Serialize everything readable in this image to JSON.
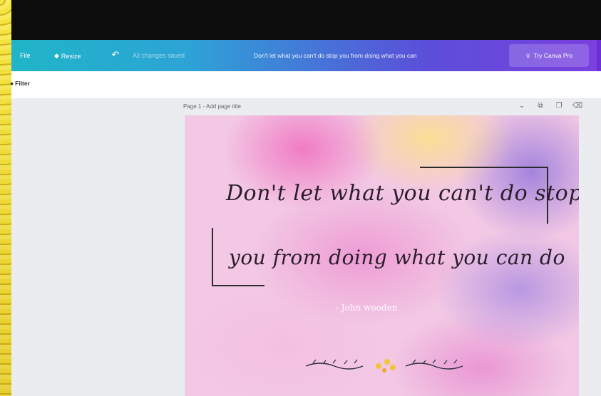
{
  "toolbar": {
    "file_label": "File",
    "resize_label": "Resize",
    "saved_status": "All changes saved",
    "design_title": "Don't let what you can't do stop you from doing what you can",
    "share_label": "Try Canva Pro"
  },
  "subbar": {
    "filter_label": "Filter"
  },
  "page": {
    "label": "Page 1 - Add page title"
  },
  "design": {
    "quote_line_1": "Don't let what you can't do stop",
    "quote_line_2": "you from doing what you can do",
    "author": "- John wooden"
  },
  "colors": {
    "toolbar_start": "#1fb5c7",
    "toolbar_end": "#7b3fe0",
    "workspace": "#ebecf0"
  }
}
